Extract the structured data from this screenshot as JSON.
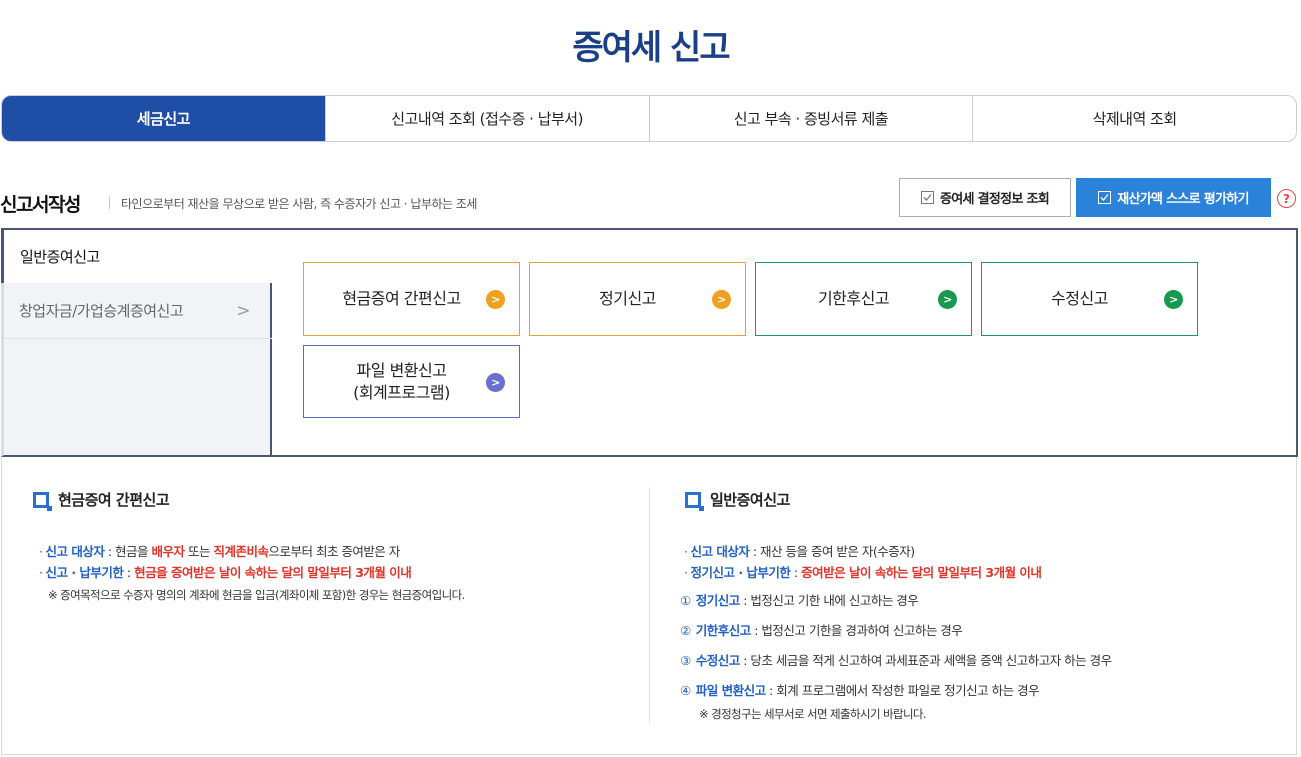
{
  "page": {
    "title": "증여세 신고"
  },
  "top_tabs": [
    {
      "label": "세금신고",
      "active": true
    },
    {
      "label": "신고내역 조회 (접수증 · 납부서)",
      "active": false
    },
    {
      "label": "신고 부속 · 증빙서류 제출",
      "active": false
    },
    {
      "label": "삭제내역 조회",
      "active": false
    }
  ],
  "section": {
    "title": "신고서작성",
    "description": "타인으로부터 재산을 무상으로 받은 사람, 즉 수증자가 신고 · 납부하는 조세"
  },
  "buttons": {
    "lookup": "증여세 결정정보 조회",
    "self_assess": "재산가액 스스로 평가하기",
    "help": "?"
  },
  "side_menu": {
    "active": "일반증여신고",
    "items": [
      {
        "label": "창업자금/가업승계증여신고",
        "chevron": ">"
      }
    ]
  },
  "options": [
    {
      "label": "현금증여 간편신고",
      "color": "#f0a020",
      "arrow": ">"
    },
    {
      "label": "정기신고",
      "color": "#f0a020",
      "arrow": ">"
    },
    {
      "label": "기한후신고",
      "color": "#17994f",
      "arrow": ">"
    },
    {
      "label": "수정신고",
      "color": "#17994f",
      "arrow": ">"
    },
    {
      "label_line1": "파일 변환신고",
      "label_line2": "(회계프로그램)",
      "color": "#6a6fd1",
      "arrow": ">"
    }
  ],
  "info_left": {
    "heading": "현금증여 간편신고",
    "line1": {
      "label": "신고 대상자",
      "sep": " : 현금을 ",
      "red1": "배우자",
      "mid": " 또는 ",
      "red2": "직계존비속",
      "tail": "으로부터 최초 증여받은 자"
    },
    "line2": {
      "label": "신고 · 납부기한",
      "sep": " : ",
      "red": "현금을 증여받은 날이 속하는 달의 말일부터 3개월 이내"
    },
    "note": "※ 증여목적으로 수증자 명의의 계좌에 현금을 입금(계좌이체 포함)한 경우는 현금증여입니다."
  },
  "info_right": {
    "heading": "일반증여신고",
    "line1": {
      "label": "신고 대상자",
      "text": " : 재산 등을 증여 받은 자(수증자)"
    },
    "line2": {
      "label": "정기신고 · 납부기한",
      "sep": " : ",
      "red": "증여받은 날이 속하는 달의 말일부터 3개월 이내"
    },
    "items": [
      {
        "num": "①",
        "label": "정기신고",
        "text": " : 법정신고 기한 내에 신고하는 경우"
      },
      {
        "num": "②",
        "label": "기한후신고",
        "text": " : 법정신고 기한을 경과하여 신고하는 경우"
      },
      {
        "num": "③",
        "label": "수정신고",
        "text": " : 당초 세금을 적게 신고하여 과세표준과 세액을 증액 신고하고자 하는 경우"
      },
      {
        "num": "④",
        "label": "파일 변환신고",
        "text": " : 회계 프로그램에서 작성한 파일로 정기신고 하는 경우"
      }
    ],
    "note": "※ 경정청구는 세무서로 서면 제출하시기 바랍니다."
  }
}
